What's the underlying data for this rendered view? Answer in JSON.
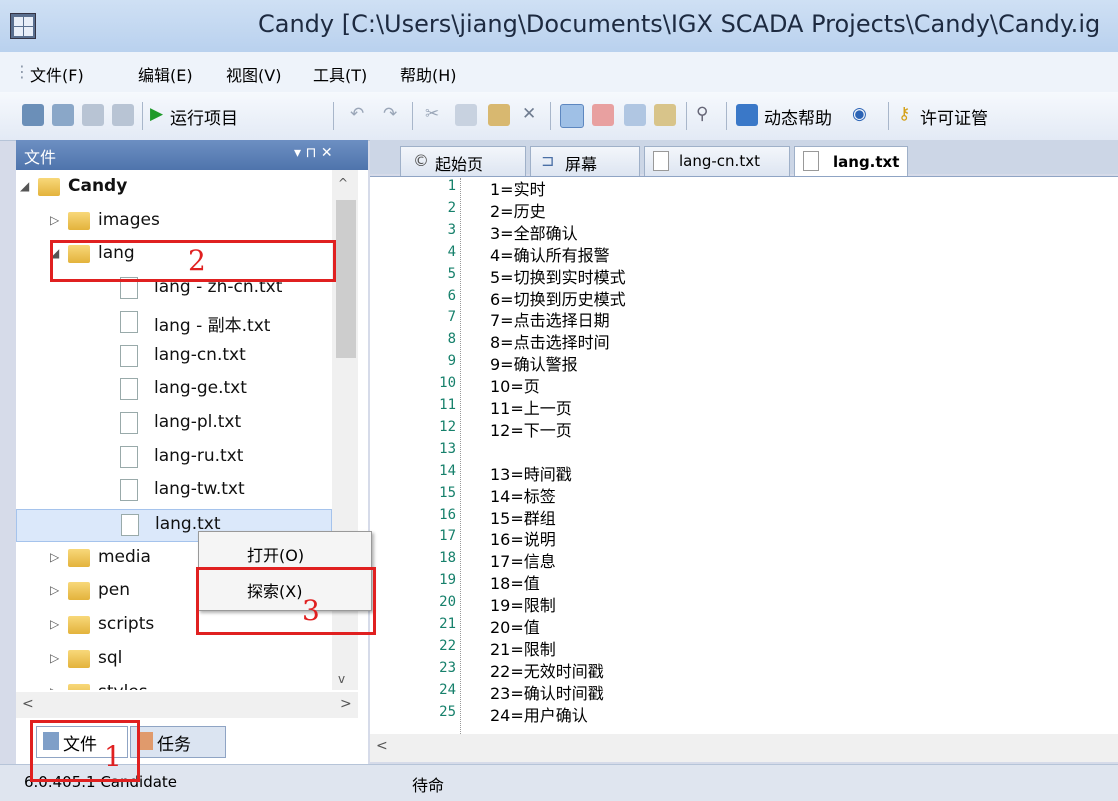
{
  "window": {
    "title": "Candy [C:\\Users\\jiang\\Documents\\IGX SCADA Projects\\Candy\\Candy.ig"
  },
  "menu": [
    "文件(F)",
    "编辑(E)",
    "视图(V)",
    "工具(T)",
    "帮助(H)"
  ],
  "toolbar": {
    "run_label": "运行项目",
    "help_label": "动态帮助",
    "license_label": "许可证管"
  },
  "left_panel": {
    "title": "文件",
    "controls": "▾ ⊓ ✕",
    "tree": [
      {
        "label": "Candy",
        "type": "folder",
        "level": 0,
        "expanded": true
      },
      {
        "label": "images",
        "type": "folder",
        "level": 1,
        "expanded": false
      },
      {
        "label": "lang",
        "type": "folder",
        "level": 1,
        "expanded": true
      },
      {
        "label": "lang - zh-cn.txt",
        "type": "file",
        "level": 2
      },
      {
        "label": "lang - 副本.txt",
        "type": "file",
        "level": 2
      },
      {
        "label": "lang-cn.txt",
        "type": "file",
        "level": 2
      },
      {
        "label": "lang-ge.txt",
        "type": "file",
        "level": 2
      },
      {
        "label": "lang-pl.txt",
        "type": "file",
        "level": 2
      },
      {
        "label": "lang-ru.txt",
        "type": "file",
        "level": 2
      },
      {
        "label": "lang-tw.txt",
        "type": "file",
        "level": 2
      },
      {
        "label": "lang.txt",
        "type": "file",
        "level": 2,
        "selected": true
      },
      {
        "label": "media",
        "type": "folder",
        "level": 1
      },
      {
        "label": "pen",
        "type": "folder",
        "level": 1
      },
      {
        "label": "scripts",
        "type": "folder",
        "level": 1
      },
      {
        "label": "sql",
        "type": "folder",
        "level": 1
      },
      {
        "label": "styles",
        "type": "folder",
        "level": 1
      }
    ],
    "bottom_tabs": [
      "文件",
      "任务"
    ]
  },
  "context_menu": {
    "open": "打开(O)",
    "explore": "探索(X)"
  },
  "doc_tabs": [
    "起始页",
    "屏幕",
    "lang-cn.txt",
    "lang.txt"
  ],
  "active_doc_tab": "lang.txt",
  "editor": {
    "lines": [
      {
        "n": "1",
        "t": "1=实时"
      },
      {
        "n": "2",
        "t": "2=历史"
      },
      {
        "n": "3",
        "t": "3=全部确认"
      },
      {
        "n": "4",
        "t": "4=确认所有报警"
      },
      {
        "n": "5",
        "t": "5=切换到实时模式"
      },
      {
        "n": "6",
        "t": "6=切换到历史模式"
      },
      {
        "n": "7",
        "t": "7=点击选择日期"
      },
      {
        "n": "8",
        "t": "8=点击选择时间"
      },
      {
        "n": "9",
        "t": "9=确认警报"
      },
      {
        "n": "10",
        "t": "10=页"
      },
      {
        "n": "11",
        "t": "11=上一页"
      },
      {
        "n": "12",
        "t": "12=下一页"
      },
      {
        "n": "13",
        "t": ""
      },
      {
        "n": "14",
        "t": "13=時间戳"
      },
      {
        "n": "15",
        "t": "14=标签"
      },
      {
        "n": "16",
        "t": "15=群组"
      },
      {
        "n": "17",
        "t": "16=说明"
      },
      {
        "n": "18",
        "t": "17=信息"
      },
      {
        "n": "19",
        "t": "18=值"
      },
      {
        "n": "20",
        "t": "19=限制"
      },
      {
        "n": "21",
        "t": "20=值"
      },
      {
        "n": "22",
        "t": "21=限制"
      },
      {
        "n": "23",
        "t": "22=无效时间戳"
      },
      {
        "n": "24",
        "t": "23=确认时间戳"
      },
      {
        "n": "25",
        "t": "24=用户确认"
      }
    ]
  },
  "status": {
    "left": "6.0.405.1 Candidate",
    "right": "待命"
  },
  "annotations": [
    "1",
    "2",
    "3"
  ],
  "colors": {
    "annotation": "#e02020",
    "panel_header": "#4f74ac",
    "line_number": "#16806b"
  }
}
